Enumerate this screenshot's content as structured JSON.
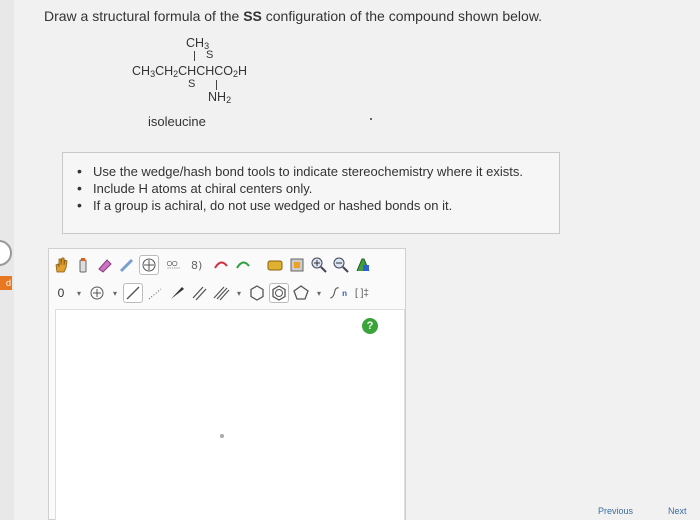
{
  "question": {
    "prefix": "Draw a structural formula of the ",
    "config": "SS",
    "suffix": " configuration of the compound shown below."
  },
  "compound": {
    "ch3": "CH",
    "ch3_sub": "3",
    "s_top": "S",
    "chain_a": "CH",
    "chain_a_sub": "3",
    "chain_b": "CH",
    "chain_b_sub": "2",
    "chain_c": "CHCHCO",
    "chain_c_sub": "2",
    "chain_d": "H",
    "s_bottom": "S",
    "nh2": "NH",
    "nh2_sub": "2",
    "name": "isoleucine"
  },
  "instructions": [
    "Use the wedge/hash bond tools to indicate stereochemistry where it exists.",
    "Include H atoms at chiral centers only.",
    "If a group is achiral, do not use wedged or hashed bonds on it."
  ],
  "toolbar": {
    "charge_value": "0",
    "charge_menu": "▾",
    "plus_menu": "▾",
    "bond_menu": "▾",
    "ring_menu": "▾",
    "bracket_label": "[ ]‡",
    "sn_label": "n",
    "help_label": "?"
  },
  "nav": {
    "prev": "Previous",
    "next": "Next"
  },
  "side": {
    "tab_label": "d"
  },
  "colors": {
    "accent_orange": "#e87722",
    "help_green": "#3aa43a",
    "link_blue": "#3a6ea5"
  }
}
